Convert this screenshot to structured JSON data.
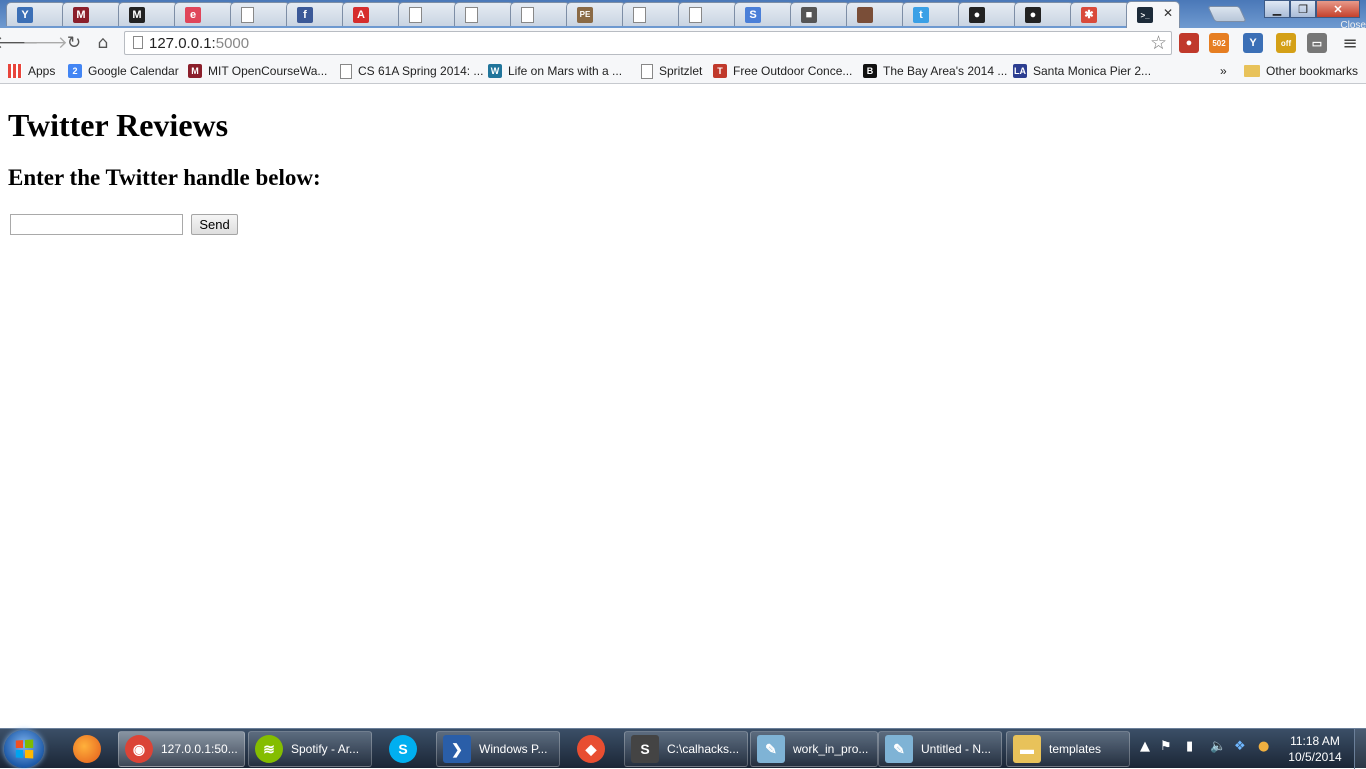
{
  "browser": {
    "tabs": [
      {
        "icon": "yammer-icon",
        "label": "",
        "color": "#3b6fb6",
        "glyph": "Y"
      },
      {
        "icon": "mit-icon",
        "label": "",
        "color": "#8b1f2b",
        "glyph": "M"
      },
      {
        "icon": "medium-icon",
        "label": "",
        "color": "#222222",
        "glyph": "M"
      },
      {
        "icon": "e-icon",
        "label": "",
        "color": "#e0455a",
        "glyph": "e"
      },
      {
        "icon": "page-icon",
        "label": "",
        "color": "",
        "glyph": ""
      },
      {
        "icon": "facebook-icon",
        "label": "",
        "color": "#3b5998",
        "glyph": "f"
      },
      {
        "icon": "angular-icon",
        "label": "",
        "color": "#d62d2d",
        "glyph": "A"
      },
      {
        "icon": "page-icon",
        "label": "",
        "color": "",
        "glyph": ""
      },
      {
        "icon": "page-icon",
        "label": "",
        "color": "",
        "glyph": ""
      },
      {
        "icon": "page-icon",
        "label": "",
        "color": "",
        "glyph": ""
      },
      {
        "icon": "pe-icon",
        "label": "",
        "color": "#8a6a45",
        "glyph": "PE"
      },
      {
        "icon": "page-icon",
        "label": "",
        "color": "",
        "glyph": ""
      },
      {
        "icon": "page-icon",
        "label": "",
        "color": "",
        "glyph": ""
      },
      {
        "icon": "s-icon",
        "label": "",
        "color": "#4a7fd8",
        "glyph": "S"
      },
      {
        "icon": "box-icon",
        "label": "",
        "color": "#555555",
        "glyph": "■"
      },
      {
        "icon": "photo-icon",
        "label": "",
        "color": "#7a4e38",
        "glyph": ""
      },
      {
        "icon": "twitter-icon",
        "label": "",
        "color": "#3aa0e6",
        "glyph": "t"
      },
      {
        "icon": "github-icon",
        "label": "",
        "color": "#222222",
        "glyph": "●"
      },
      {
        "icon": "github-icon",
        "label": "",
        "color": "#222222",
        "glyph": "●"
      },
      {
        "icon": "pinwheel-icon",
        "label": "",
        "color": "#d94a3a",
        "glyph": "✱"
      },
      {
        "icon": "terminal-icon",
        "label": "",
        "color": "#1d2b3a",
        "glyph": ">_",
        "active": true
      }
    ],
    "close_tooltip": "Close",
    "url_host": "127.0.0.1:",
    "url_port": "5000",
    "bookmarks": [
      {
        "label": "Apps",
        "icon": "apps-grid-icon",
        "color": "#e8453c"
      },
      {
        "label": "Google Calendar",
        "icon": "google-calendar-icon",
        "color": "#4285f4",
        "glyph": "2"
      },
      {
        "label": "MIT OpenCourseWa...",
        "icon": "mit-ocw-icon",
        "color": "#8b1f2b",
        "glyph": "M"
      },
      {
        "label": "CS 61A Spring 2014: ...",
        "icon": "page-icon",
        "color": ""
      },
      {
        "label": "Life on Mars with a ...",
        "icon": "wordpress-icon",
        "color": "#21759b",
        "glyph": "W"
      },
      {
        "label": "Spritzlet",
        "icon": "page-icon",
        "color": ""
      },
      {
        "label": "Free Outdoor Conce...",
        "icon": "concert-icon",
        "color": "#c0392b",
        "glyph": "T"
      },
      {
        "label": "The Bay Area's 2014 ...",
        "icon": "bay-area-icon",
        "color": "#111111",
        "glyph": "B"
      },
      {
        "label": "Santa Monica Pier 2...",
        "icon": "la-icon",
        "color": "#2c3e91",
        "glyph": "LA"
      }
    ],
    "bookmarks_overflow": "»",
    "other_bookmarks": "Other bookmarks",
    "extensions": [
      {
        "icon": "adblock-icon",
        "color": "#c0392b",
        "glyph": "●"
      },
      {
        "icon": "rss-icon",
        "color": "#e67e22",
        "glyph": "502"
      },
      {
        "icon": "yammer-ext-icon",
        "color": "#3b6fb6",
        "glyph": "Y"
      },
      {
        "icon": "off-icon",
        "color": "#d4a017",
        "glyph": "off"
      },
      {
        "icon": "cast-icon",
        "color": "#777777",
        "glyph": "▭"
      }
    ]
  },
  "page": {
    "title": "Twitter Reviews",
    "subtitle": "Enter the Twitter handle below:",
    "input_value": "",
    "send_label": "Send"
  },
  "taskbar": {
    "items": [
      {
        "label": "127.0.0.1:50...",
        "icon": "chrome-icon",
        "color": "#db4437",
        "active": true
      },
      {
        "label": "Spotify - Ar...",
        "icon": "spotify-icon",
        "color": "#84bd00"
      },
      {
        "label": "Windows P...",
        "icon": "powershell-icon",
        "color": "#2a5ea8"
      },
      {
        "label": "C:\\calhacks...",
        "icon": "sublime-icon",
        "color": "#444444"
      },
      {
        "label": "work_in_pro...",
        "icon": "notepad-icon",
        "color": "#7fb3d5"
      },
      {
        "label": "Untitled - N...",
        "icon": "notepad-icon",
        "color": "#7fb3d5"
      },
      {
        "label": "templates",
        "icon": "folder-icon",
        "color": "#e8c25a"
      }
    ],
    "time": "11:18 AM",
    "date": "10/5/2014"
  }
}
